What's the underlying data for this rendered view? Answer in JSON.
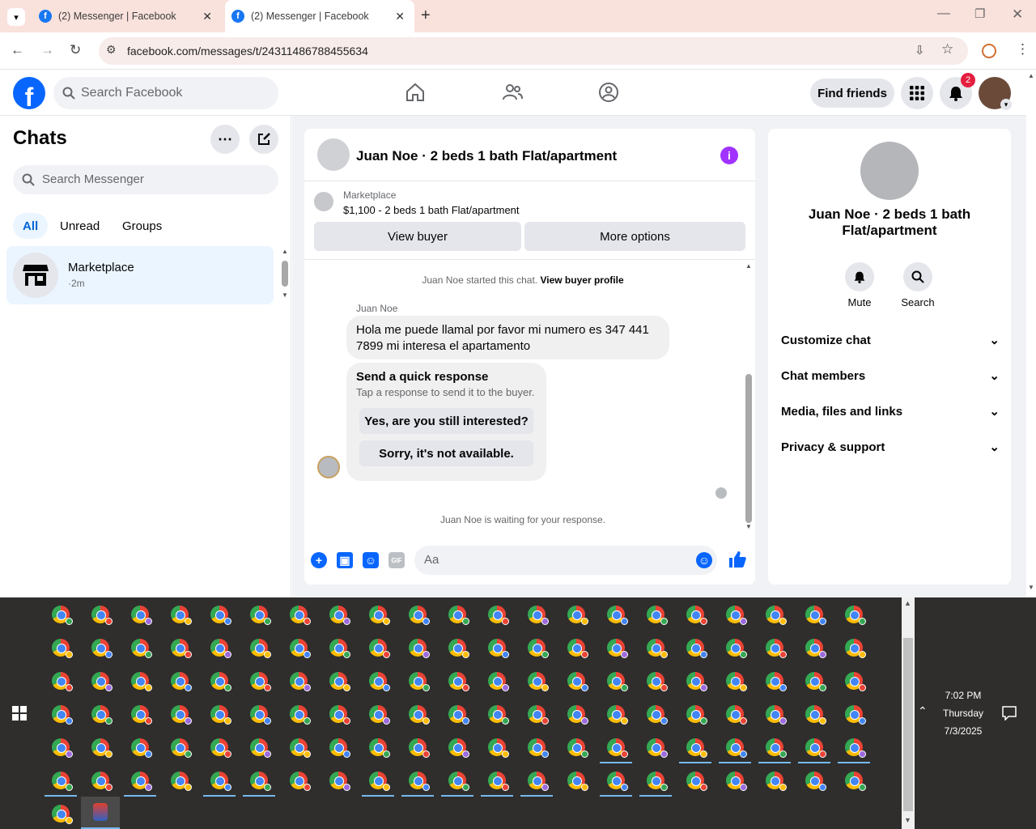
{
  "browser": {
    "tabs": [
      {
        "title": "(2) Messenger | Facebook"
      },
      {
        "title": "(2) Messenger | Facebook"
      }
    ],
    "url": "facebook.com/messages/t/24311486788455634"
  },
  "fb_header": {
    "logo_letter": "f",
    "search_placeholder": "Search Facebook",
    "find_friends": "Find friends",
    "notification_count": "2"
  },
  "chats": {
    "title": "Chats",
    "search_placeholder": "Search Messenger",
    "filters": [
      "All",
      "Unread",
      "Groups"
    ],
    "items": [
      {
        "name": "Marketplace",
        "meta": "·2m"
      }
    ]
  },
  "conversation": {
    "title": "Juan Noe · 2 beds 1 bath Flat/apartment",
    "marketplace_label": "Marketplace",
    "listing": "$1,100 - 2 beds 1 bath Flat/apartment",
    "view_buyer": "View buyer",
    "more_options": "More options",
    "started_text": "Juan Noe started this chat.",
    "view_buyer_profile": "View buyer profile",
    "sender_name": "Juan Noe",
    "message": "Hola me puede llamal por favor mi numero es 347 441 7899  mi interesa el apartamento",
    "quick_title": "Send a quick response",
    "quick_subtitle": "Tap a response to send it to the buyer.",
    "quick_replies": [
      "Yes, are you still interested?",
      "Sorry, it's not available."
    ],
    "waiting_text": "Juan Noe is waiting for your response.",
    "composer_placeholder": "Aa"
  },
  "details": {
    "name": "Juan Noe · 2 beds 1 bath Flat/apartment",
    "actions": [
      "Mute",
      "Search"
    ],
    "sections": [
      "Customize chat",
      "Chat members",
      "Media, files and links",
      "Privacy & support"
    ]
  },
  "taskbar": {
    "time": "7:02 PM",
    "day": "Thursday",
    "date": "7/3/2025"
  },
  "colors": {
    "fb_blue": "#0866ff",
    "tab_strip": "#f9e1dc",
    "active_filter_bg": "#ebf5ff",
    "info_purple": "#a033ff"
  }
}
